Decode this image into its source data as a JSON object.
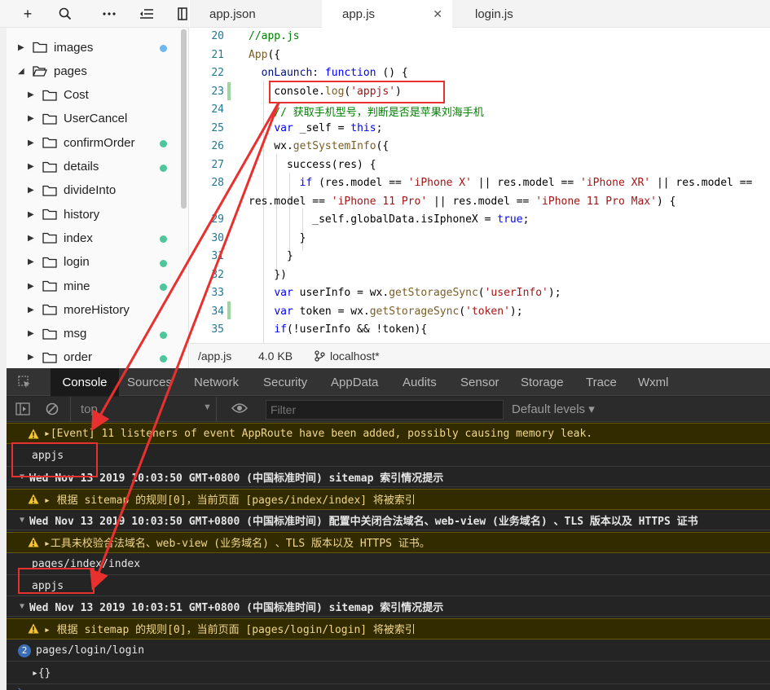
{
  "tree": {
    "toolbar": {
      "add": "+",
      "search": "search-icon",
      "more": "more-icon",
      "collapse": "collapse-icon",
      "layout": "layout-icon"
    },
    "items": [
      {
        "label": "images",
        "expanded": false,
        "indent": 0,
        "dot": "#6db8f0"
      },
      {
        "label": "pages",
        "expanded": true,
        "indent": 0,
        "dot": ""
      },
      {
        "label": "Cost",
        "expanded": false,
        "indent": 1,
        "dot": ""
      },
      {
        "label": "UserCancel",
        "expanded": false,
        "indent": 1,
        "dot": ""
      },
      {
        "label": "confirmOrder",
        "expanded": false,
        "indent": 1,
        "dot": "#4ec59a"
      },
      {
        "label": "details",
        "expanded": false,
        "indent": 1,
        "dot": "#4ec59a"
      },
      {
        "label": "divideInto",
        "expanded": false,
        "indent": 1,
        "dot": ""
      },
      {
        "label": "history",
        "expanded": false,
        "indent": 1,
        "dot": ""
      },
      {
        "label": "index",
        "expanded": false,
        "indent": 1,
        "dot": "#4ec59a"
      },
      {
        "label": "login",
        "expanded": false,
        "indent": 1,
        "dot": "#4ec59a"
      },
      {
        "label": "mine",
        "expanded": false,
        "indent": 1,
        "dot": "#4ec59a"
      },
      {
        "label": "moreHistory",
        "expanded": false,
        "indent": 1,
        "dot": ""
      },
      {
        "label": "msg",
        "expanded": false,
        "indent": 1,
        "dot": "#4ec59a"
      },
      {
        "label": "order",
        "expanded": false,
        "indent": 1,
        "dot": "#4ec59a"
      }
    ]
  },
  "editor": {
    "tabs": [
      {
        "label": "app.json",
        "active": false
      },
      {
        "label": "app.js",
        "active": true
      },
      {
        "label": "login.js",
        "active": false
      }
    ],
    "close_glyph": "✕",
    "lines": [
      {
        "n": "20",
        "parts": [
          {
            "t": "//app.js",
            "c": "cm"
          }
        ]
      },
      {
        "n": "21",
        "parts": [
          {
            "t": "App",
            "c": "fn"
          },
          {
            "t": "({",
            "c": ""
          }
        ]
      },
      {
        "n": "22",
        "parts": [
          {
            "t": "  onLaunch: ",
            "c": "pr"
          },
          {
            "t": "function",
            "c": "kw"
          },
          {
            "t": " () {",
            "c": ""
          }
        ]
      },
      {
        "n": "23",
        "parts": [
          {
            "t": "    console.",
            "c": ""
          },
          {
            "t": "log",
            "c": "fn"
          },
          {
            "t": "(",
            "c": ""
          },
          {
            "t": "'appjs'",
            "c": "st"
          },
          {
            "t": ")",
            "c": ""
          }
        ]
      },
      {
        "n": "24",
        "parts": [
          {
            "t": "    // 获取手机型号，判断是否是苹果刘海手机",
            "c": "cm"
          }
        ]
      },
      {
        "n": "25",
        "parts": [
          {
            "t": "    ",
            "c": ""
          },
          {
            "t": "var",
            "c": "kw"
          },
          {
            "t": " _self = ",
            "c": ""
          },
          {
            "t": "this",
            "c": "kw"
          },
          {
            "t": ";",
            "c": ""
          }
        ]
      },
      {
        "n": "26",
        "parts": [
          {
            "t": "    wx.",
            "c": ""
          },
          {
            "t": "getSystemInfo",
            "c": "fn"
          },
          {
            "t": "({",
            "c": ""
          }
        ]
      },
      {
        "n": "27",
        "parts": [
          {
            "t": "      success(res) {",
            "c": ""
          }
        ]
      },
      {
        "n": "28",
        "parts": [
          {
            "t": "        ",
            "c": ""
          },
          {
            "t": "if",
            "c": "kw"
          },
          {
            "t": " (res.model == ",
            "c": ""
          },
          {
            "t": "'iPhone X'",
            "c": "st"
          },
          {
            "t": " || res.model == ",
            "c": ""
          },
          {
            "t": "'iPhone XR'",
            "c": "st"
          },
          {
            "t": " || res.model ==",
            "c": ""
          }
        ]
      },
      {
        "n": "",
        "parts": [
          {
            "t": "res.model == ",
            "c": ""
          },
          {
            "t": "'iPhone 11 Pro'",
            "c": "st"
          },
          {
            "t": " || res.model == ",
            "c": ""
          },
          {
            "t": "'iPhone 11 Pro Max'",
            "c": "st"
          },
          {
            "t": ") {",
            "c": ""
          }
        ]
      },
      {
        "n": "29",
        "parts": [
          {
            "t": "          _self.globalData.isIphoneX = ",
            "c": ""
          },
          {
            "t": "true",
            "c": "kw"
          },
          {
            "t": ";",
            "c": ""
          }
        ]
      },
      {
        "n": "30",
        "parts": [
          {
            "t": "        }",
            "c": ""
          }
        ]
      },
      {
        "n": "31",
        "parts": [
          {
            "t": "      }",
            "c": ""
          }
        ]
      },
      {
        "n": "32",
        "parts": [
          {
            "t": "    })",
            "c": ""
          }
        ]
      },
      {
        "n": "33",
        "parts": [
          {
            "t": "    ",
            "c": ""
          },
          {
            "t": "var",
            "c": "kw"
          },
          {
            "t": " userInfo = wx.",
            "c": ""
          },
          {
            "t": "getStorageSync",
            "c": "fn"
          },
          {
            "t": "(",
            "c": ""
          },
          {
            "t": "'userInfo'",
            "c": "st"
          },
          {
            "t": ");",
            "c": ""
          }
        ]
      },
      {
        "n": "34",
        "parts": [
          {
            "t": "    ",
            "c": ""
          },
          {
            "t": "var",
            "c": "kw"
          },
          {
            "t": " token = wx.",
            "c": ""
          },
          {
            "t": "getStorageSync",
            "c": "fn"
          },
          {
            "t": "(",
            "c": ""
          },
          {
            "t": "'token'",
            "c": "st"
          },
          {
            "t": ");",
            "c": ""
          }
        ]
      },
      {
        "n": "35",
        "parts": [
          {
            "t": "    ",
            "c": ""
          },
          {
            "t": "if",
            "c": "kw"
          },
          {
            "t": "(!userInfo && !token){",
            "c": ""
          }
        ]
      }
    ],
    "status": {
      "file": "/app.js",
      "size": "4.0 KB",
      "branch_icon": "branch-icon",
      "branch": "localhost*"
    }
  },
  "devtools": {
    "tabs": [
      "Console",
      "Sources",
      "Network",
      "Security",
      "AppData",
      "Audits",
      "Sensor",
      "Storage",
      "Trace",
      "Wxml"
    ],
    "active_tab": "Console",
    "context": "top",
    "filter_placeholder": "Filter",
    "levels": "Default levels ▾",
    "rows": [
      {
        "kind": "warn",
        "text": "▸[Event] 11 listeners of event AppRoute have been added, possibly causing memory leak."
      },
      {
        "kind": "log",
        "text": "appjs"
      },
      {
        "kind": "group",
        "text": "Wed Nov 13 2019 10:03:50 GMT+0800 (中国标准时间) sitemap 索引情况提示"
      },
      {
        "kind": "warn",
        "text": "▸ 根据 sitemap 的规则[0]，当前页面 [pages/index/index] 将被索引"
      },
      {
        "kind": "group",
        "text": "Wed Nov 13 2019 10:03:50 GMT+0800 (中国标准时间) 配置中关闭合法域名、web-view (业务域名) 、TLS 版本以及 HTTPS 证书"
      },
      {
        "kind": "warn",
        "text": "▸工具未校验合法域名、web-view (业务域名) 、TLS 版本以及 HTTPS 证书。"
      },
      {
        "kind": "log",
        "text": "pages/index/index"
      },
      {
        "kind": "log",
        "text": "appjs"
      },
      {
        "kind": "group",
        "text": "Wed Nov 13 2019 10:03:51 GMT+0800 (中国标准时间) sitemap 索引情况提示"
      },
      {
        "kind": "warn",
        "text": "▸ 根据 sitemap 的规则[0]，当前页面 [pages/login/login] 将被索引"
      },
      {
        "kind": "log",
        "badge": "2",
        "text": "pages/login/login"
      },
      {
        "kind": "log",
        "text": "▸{}"
      },
      {
        "kind": "prompt",
        "text": "›"
      }
    ]
  },
  "colors": {
    "highlight": "#e8312f",
    "accent_green": "#4ec59a",
    "accent_blue": "#6db8f0"
  }
}
